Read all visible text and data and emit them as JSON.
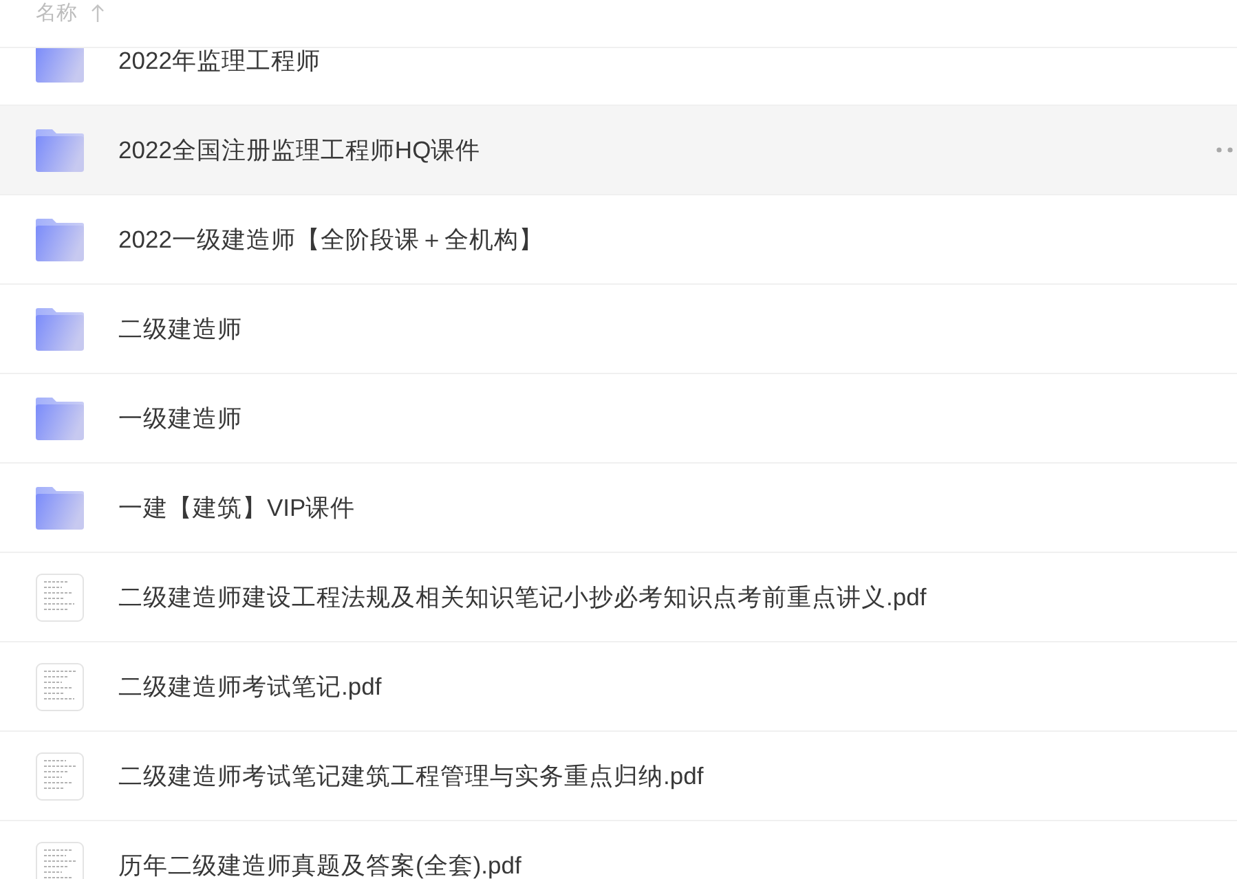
{
  "header": {
    "label": "名称",
    "sorted": true
  },
  "files": [
    {
      "kind": "folder",
      "name": "2022年监理工程师",
      "highlighted": false
    },
    {
      "kind": "folder",
      "name": "2022全国注册监理工程师HQ课件",
      "highlighted": true
    },
    {
      "kind": "folder",
      "name": "2022一级建造师【全阶段课＋全机构】",
      "highlighted": false
    },
    {
      "kind": "folder",
      "name": "二级建造师",
      "highlighted": false
    },
    {
      "kind": "folder",
      "name": "一级建造师",
      "highlighted": false
    },
    {
      "kind": "folder",
      "name": "一建【建筑】VIP课件",
      "highlighted": false
    },
    {
      "kind": "document",
      "name": "二级建造师建设工程法规及相关知识笔记小抄必考知识点考前重点讲义.pdf",
      "highlighted": false
    },
    {
      "kind": "document",
      "name": "二级建造师考试笔记.pdf",
      "highlighted": false
    },
    {
      "kind": "document",
      "name": "二级建造师考试笔记建筑工程管理与实务重点归纳.pdf",
      "highlighted": false
    },
    {
      "kind": "document",
      "name": "历年二级建造师真题及答案(全套).pdf",
      "highlighted": false
    }
  ]
}
